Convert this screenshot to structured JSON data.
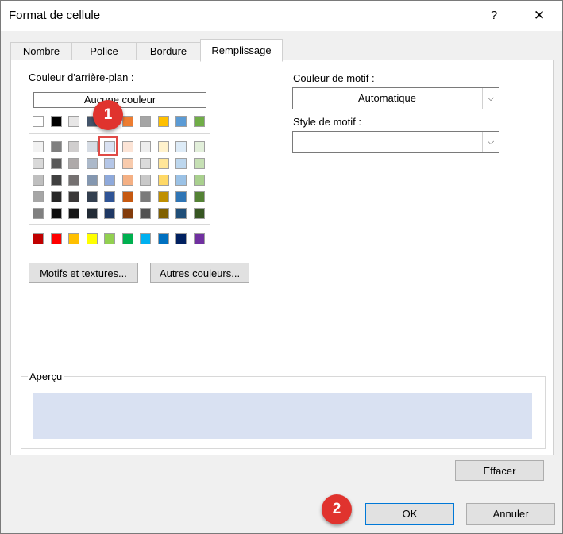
{
  "dialog": {
    "title": "Format de cellule",
    "help_label": "?",
    "close_label": "✕"
  },
  "tabs": [
    {
      "label": "Nombre"
    },
    {
      "label": "Police"
    },
    {
      "label": "Bordure"
    },
    {
      "label": "Remplissage"
    }
  ],
  "active_tab": "Remplissage",
  "background": {
    "label": "Couleur d'arrière-plan :",
    "no_color_label": "Aucune couleur",
    "top_row": [
      "#ffffff",
      "#000000",
      "#e7e6e6",
      "#44546a",
      "#4472c4",
      "#ed7d31",
      "#a5a5a5",
      "#ffc000",
      "#5b9bd5",
      "#70ad47"
    ],
    "shade_rows": [
      [
        "#f2f2f2",
        "#7f7f7f",
        "#d0cece",
        "#d6dce4",
        "#d9e1f2",
        "#fce4d6",
        "#ededed",
        "#fff2cc",
        "#ddebf7",
        "#e2efda"
      ],
      [
        "#d9d9d9",
        "#595959",
        "#aeaaaa",
        "#acb9ca",
        "#b4c6e7",
        "#f8cbad",
        "#dbdbdb",
        "#ffe699",
        "#bdd7ee",
        "#c6e0b4"
      ],
      [
        "#bfbfbf",
        "#404040",
        "#757171",
        "#8497b0",
        "#8ea9db",
        "#f4b084",
        "#c9c9c9",
        "#ffd966",
        "#9bc2e6",
        "#a9d08e"
      ],
      [
        "#a6a6a6",
        "#262626",
        "#3a3838",
        "#333f4f",
        "#2f5496",
        "#c65911",
        "#7b7b7b",
        "#bf8f00",
        "#2f75b5",
        "#548235"
      ],
      [
        "#808080",
        "#0d0d0d",
        "#161616",
        "#222b35",
        "#1f3864",
        "#833c0c",
        "#525252",
        "#806000",
        "#1f4e78",
        "#375623"
      ]
    ],
    "standard_row": [
      "#c00000",
      "#ff0000",
      "#ffc000",
      "#ffff00",
      "#92d050",
      "#00b050",
      "#00b0f0",
      "#0070c0",
      "#002060",
      "#7030a0"
    ],
    "selected_color": "#d9e1f2"
  },
  "buttons": {
    "patterns": "Motifs et textures...",
    "more_colors": "Autres couleurs...",
    "clear": "Effacer",
    "ok": "OK",
    "cancel": "Annuler"
  },
  "pattern_color": {
    "label": "Couleur de motif :",
    "value": "Automatique"
  },
  "pattern_style": {
    "label": "Style de motif :",
    "value": ""
  },
  "preview": {
    "label": "Aperçu",
    "fill": "#d9e1f2"
  },
  "markers": {
    "one": "1",
    "two": "2"
  }
}
